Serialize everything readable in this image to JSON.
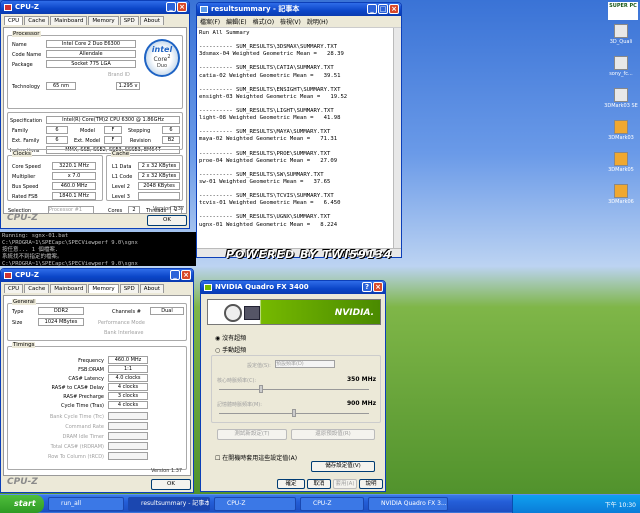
{
  "cpuz1": {
    "title": "CPU-Z",
    "tabs": [
      "CPU",
      "Cache",
      "Mainboard",
      "Memory",
      "SPD",
      "About"
    ],
    "processor_label": "Processor",
    "rows": [
      [
        "Name",
        "Intel Core 2 Duo E6300"
      ],
      [
        "Code Name",
        "Allendale"
      ],
      [
        "Package",
        "Socket 775 LGA"
      ]
    ],
    "brand_id_label": "Brand ID",
    "technology_label": "Technology",
    "technology": "65 nm",
    "voltage": "1.295 v",
    "spec_label": "Specification",
    "spec": "Intel(R) Core(TM)2 CPU          6300  @ 1.86GHz",
    "family_label": "Family",
    "family": "6",
    "model_label": "Model",
    "model": "F",
    "stepping_label": "Stepping",
    "stepping": "6",
    "extfamily_label": "Ext. Family",
    "extfamily": "6",
    "extmodel_label": "Ext. Model",
    "extmodel": "F",
    "revision_label": "Revision",
    "revision": "B2",
    "instr_label": "Instructions",
    "instr": "MMX, SSE, SSE2, SSE3, SSSE3, EM64T",
    "clocks_label": "Clocks",
    "core_speed_label": "Core Speed",
    "core_speed": "3220.1 MHz",
    "multiplier_label": "Multiplier",
    "multiplier": "x 7.0",
    "bus_speed_label": "Bus Speed",
    "bus_speed": "460.0 MHz",
    "rated_fsb_label": "Rated FSB",
    "rated_fsb": "1840.1 MHz",
    "cache_label": "Cache",
    "l1data_label": "L1 Data",
    "l1data": "2 x 32 KBytes",
    "l1code_label": "L1 Code",
    "l1code": "2 x 32 KBytes",
    "level2_label": "Level 2",
    "level2": "2048 KBytes",
    "level3_label": "Level 3",
    "level3": "",
    "selection_label": "Selection",
    "selection": "Processor #1",
    "cores_label": "Cores",
    "cores": "2",
    "threads_label": "Threads",
    "threads": "2",
    "version": "Version 1.37",
    "brand": "CPU-Z",
    "ok": "OK",
    "logo_top": "intel",
    "logo_mid": "Core",
    "logo_bot": "2",
    "logo_sub": "Duo"
  },
  "cmd": {
    "lines": [
      "Running: sgnx-01.bat",
      "C:\\PROGRA~1\\SPECapc\\SPECViewperf 9.0\\sgnx",
      "按任意... 1 個檔案.",
      "系統找不到指定的檔案。",
      "C:\\PROGRA~1\\SPECapc\\SPECViewperf 9.0\\sgnx"
    ]
  },
  "notepad": {
    "title": "resultsummary - 記事本",
    "menu": [
      "檔案(F)",
      "編輯(E)",
      "格式(O)",
      "檢視(V)",
      "說明(H)"
    ],
    "text": "Run All Summary\n\n---------- SUM_RESULTS\\3DSMAX\\SUMMARY.TXT\n3dsmax-04 Weighted Geometric Mean =   28.39\n\n---------- SUM_RESULTS\\CATIA\\SUMMARY.TXT\ncatia-02 Weighted Geometric Mean =   39.51\n\n---------- SUM_RESULTS\\ENSIGHT\\SUMMARY.TXT\nensight-03 Weighted Geometric Mean =   19.52\n\n---------- SUM_RESULTS\\LIGHT\\SUMMARY.TXT\nlight-08 Weighted Geometric Mean =   41.98\n\n---------- SUM_RESULTS\\MAYA\\SUMMARY.TXT\nmaya-02 Weighted Geometric Mean =   71.31\n\n---------- SUM_RESULTS\\PROE\\SUMMARY.TXT\nproe-04 Weighted Geometric Mean =   27.09\n\n---------- SUM_RESULTS\\SW\\SUMMARY.TXT\nsw-01 Weighted Geometric Mean =   37.65\n\n---------- SUM_RESULTS\\TCVIS\\SUMMARY.TXT\ntcvis-01 Weighted Geometric Mean =   6.450\n\n---------- SUM_RESULTS\\UGNX\\SUMMARY.TXT\nugnx-01 Weighted Geometric Mean =   8.224\n"
  },
  "watermark": "POWERED BY TWI59134",
  "cpuz2": {
    "title": "CPU-Z",
    "tabs": [
      "CPU",
      "Cache",
      "Mainboard",
      "Memory",
      "SPD",
      "About"
    ],
    "general_label": "General",
    "type_label": "Type",
    "type": "DDR2",
    "channels_label": "Channels #",
    "channels": "Dual",
    "size_label": "Size",
    "size": "1024 MBytes",
    "perf_mode_label": "Performance Mode",
    "bank_label": "Bank Interleave",
    "timings_label": "Timings",
    "timings": [
      [
        "Frequency",
        "460.0 MHz"
      ],
      [
        "FSB:DRAM",
        "1:1"
      ],
      [
        "CAS# Latency",
        "4.0 clocks"
      ],
      [
        "RAS# to CAS# Delay",
        "4 clocks"
      ],
      [
        "RAS# Precharge",
        "3 clocks"
      ],
      [
        "Cycle Time (Tras)",
        "4 clocks"
      ]
    ],
    "dim_rows": [
      "Bank Cycle Time (Trc)",
      "Command Rate",
      "DRAM Idle Timer",
      "Total CAS# (tRDRAM)",
      "Row To Column (tRCD)"
    ],
    "version": "Version 1.37",
    "brand": "CPU-Z",
    "ok": "OK"
  },
  "nvidia": {
    "title": "NVIDIA Quadro FX 3400",
    "brand": "NVIDIA.",
    "opt1": "沒有超頻",
    "opt2": "手動超頻",
    "preset_label": "設定值(S):",
    "preset": "預設頻率(D)",
    "core_label": "核心時脈頻率(C):",
    "core_val": "350 MHz",
    "mem_label": "記憶體時脈頻率(M):",
    "mem_val": "900 MHz",
    "test_btn": "測試新設定(T)",
    "restore_btn": "還原預設值(R)",
    "startup_chk": "在開機時套用這些設定值(A)",
    "save_btn": "儲存設定值(V)",
    "ok": "確定",
    "cancel": "取消",
    "apply": "套用(A)",
    "help": "說明",
    "core_level": 0.28,
    "mem_level": 0.5
  },
  "desktop": {
    "icons": [
      {
        "label": "3D_Quali",
        "icon": "app-icon"
      },
      {
        "label": "sony_fc...",
        "icon": "app-icon"
      },
      {
        "label": "3DMark03 SE",
        "icon": "app-icon"
      },
      {
        "label": "3DMark03",
        "icon": "doc-icon"
      },
      {
        "label": "3DMark05",
        "icon": "doc-icon"
      },
      {
        "label": "3DMark06",
        "icon": "doc-icon"
      }
    ],
    "corner_logo": "SUPER PC"
  },
  "taskbar": {
    "start": "start",
    "items": [
      "run_all",
      "resultsummary - 記事本",
      "CPU-Z",
      "CPU-Z",
      "NVIDIA Quadro FX 3..."
    ],
    "active": 1,
    "clock": "下午 10:30"
  }
}
